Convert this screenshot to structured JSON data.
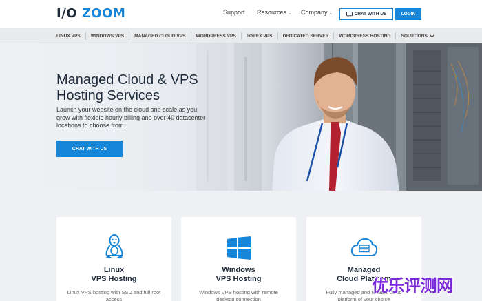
{
  "logo": {
    "part1": "I/O",
    "part2": "ZOOM"
  },
  "topnav": {
    "support": "Support",
    "resources": "Resources",
    "company": "Company",
    "chat_button": "CHAT WITH US",
    "login_button": "LOGIN"
  },
  "subnav": {
    "items": [
      {
        "label": "LINUX VPS"
      },
      {
        "label": "WINDOWS VPS"
      },
      {
        "label": "MANAGED CLOUD VPS"
      },
      {
        "label": "WORDPRESS VPS"
      },
      {
        "label": "FOREX VPS"
      },
      {
        "label": "DEDICATED SERVER"
      },
      {
        "label": "WORDPRESS HOSTING"
      },
      {
        "label": "SOLUTIONS"
      }
    ]
  },
  "hero": {
    "title": "Managed Cloud & VPS Hosting Services",
    "text": "Launch your website on the cloud and scale as you grow with flexible hourly billing and over 40 datacenter locations to choose from.",
    "cta": "CHAT WITH US"
  },
  "cards": [
    {
      "title_line1": "Linux",
      "title_line2": "VPS Hosting",
      "desc": "Linux VPS hosting with SSD and full root access",
      "icon": "linux-penguin-icon"
    },
    {
      "title_line1": "Windows",
      "title_line2": "VPS Hosting",
      "desc": "Windows VPS hosting with remote desktop connection",
      "icon": "windows-logo-icon"
    },
    {
      "title_line1": "Managed",
      "title_line2": "Cloud Platform",
      "desc": "Fully managed and reliable cloud platform of your choice",
      "icon": "cloud-server-icon"
    }
  ],
  "watermark": "优乐评测网",
  "colors": {
    "brand_blue": "#1586d9",
    "dark_text": "#1d2a3a",
    "tie_red": "#b3202e",
    "lanyard_blue": "#1b4fa8"
  }
}
